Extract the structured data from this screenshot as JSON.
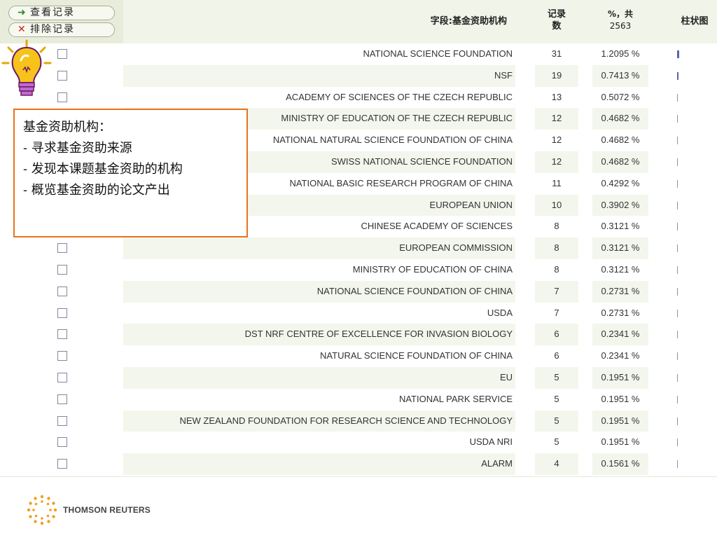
{
  "actions": {
    "view_records": "查看记录",
    "exclude_records": "排除记录"
  },
  "header": {
    "field": "字段:基金资助机构",
    "count": "记录数",
    "pct_label": "%，共",
    "pct_total": "2563",
    "bar": "柱状图"
  },
  "rows": [
    {
      "name": "NATIONAL SCIENCE FOUNDATION",
      "count": "31",
      "pct": "1.2095 %"
    },
    {
      "name": "NSF",
      "count": "19",
      "pct": "0.7413 %"
    },
    {
      "name": "ACADEMY OF SCIENCES OF THE CZECH REPUBLIC",
      "count": "13",
      "pct": "0.5072 %"
    },
    {
      "name": "MINISTRY OF EDUCATION OF THE CZECH REPUBLIC",
      "count": "12",
      "pct": "0.4682 %"
    },
    {
      "name": "NATIONAL NATURAL SCIENCE FOUNDATION OF CHINA",
      "count": "12",
      "pct": "0.4682 %"
    },
    {
      "name": "SWISS NATIONAL SCIENCE FOUNDATION",
      "count": "12",
      "pct": "0.4682 %"
    },
    {
      "name": "NATIONAL BASIC RESEARCH PROGRAM OF CHINA",
      "count": "11",
      "pct": "0.4292 %"
    },
    {
      "name": "EUROPEAN UNION",
      "count": "10",
      "pct": "0.3902 %"
    },
    {
      "name": "CHINESE ACADEMY OF SCIENCES",
      "count": "8",
      "pct": "0.3121 %"
    },
    {
      "name": "EUROPEAN COMMISSION",
      "count": "8",
      "pct": "0.3121 %"
    },
    {
      "name": "MINISTRY OF EDUCATION OF CHINA",
      "count": "8",
      "pct": "0.3121 %"
    },
    {
      "name": "NATIONAL SCIENCE FOUNDATION OF CHINA",
      "count": "7",
      "pct": "0.2731 %"
    },
    {
      "name": "USDA",
      "count": "7",
      "pct": "0.2731 %"
    },
    {
      "name": "DST NRF CENTRE OF EXCELLENCE FOR INVASION BIOLOGY",
      "count": "6",
      "pct": "0.2341 %"
    },
    {
      "name": "NATURAL SCIENCE FOUNDATION OF CHINA",
      "count": "6",
      "pct": "0.2341 %"
    },
    {
      "name": "EU",
      "count": "5",
      "pct": "0.1951 %"
    },
    {
      "name": "NATIONAL PARK SERVICE",
      "count": "5",
      "pct": "0.1951 %"
    },
    {
      "name": "NEW ZEALAND FOUNDATION FOR RESEARCH SCIENCE AND TECHNOLOGY",
      "count": "5",
      "pct": "0.1951 %"
    },
    {
      "name": "USDA NRI",
      "count": "5",
      "pct": "0.1951 %"
    },
    {
      "name": "ALARM",
      "count": "4",
      "pct": "0.1561 %"
    }
  ],
  "callout": {
    "lines": [
      "基金资助机构：",
      "- 寻求基金资助来源",
      "- 发现本课题基金资助的机构",
      "- 概览基金资助的论文产出"
    ]
  },
  "logo": {
    "text": "THOMSON REUTERS"
  },
  "colors": {
    "callout_border": "#e8731c",
    "bar": "#5a63a8",
    "bulb": "#f7c21a"
  },
  "icons": {
    "view": "arrow-right-icon",
    "exclude": "x-icon",
    "bulb": "lightbulb-icon",
    "logo": "thomson-reuters-logo-icon"
  }
}
